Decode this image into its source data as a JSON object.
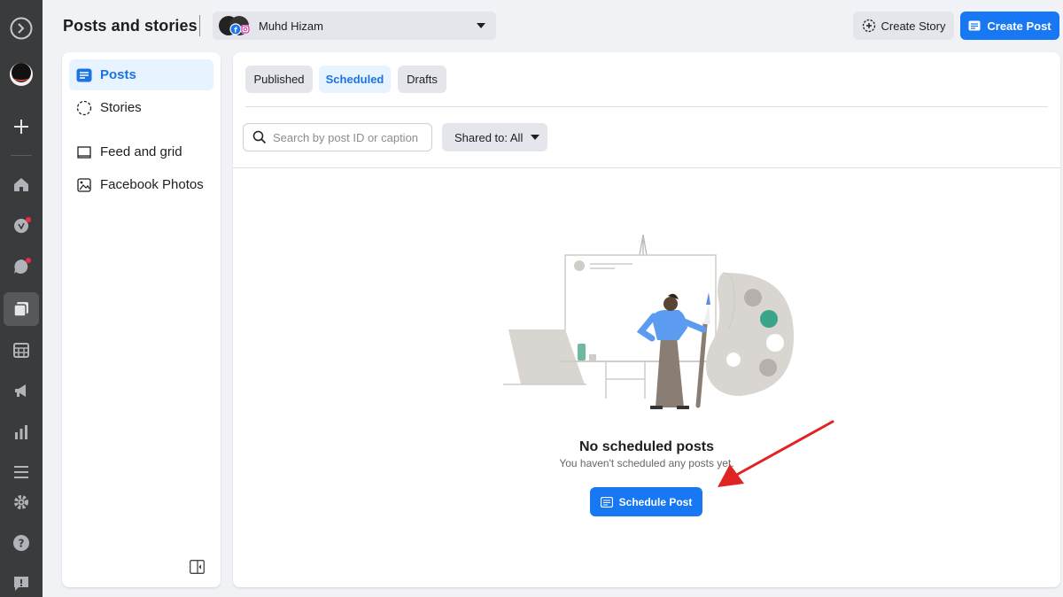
{
  "header": {
    "title": "Posts and stories",
    "account_name": "Muhd Hizam",
    "create_story_label": "Create Story",
    "create_post_label": "Create Post"
  },
  "rail": {
    "icons": [
      "meta-logo-icon",
      "profile-avatar",
      "plus-icon",
      "home-icon",
      "notifications-icon",
      "inbox-icon",
      "posts-icon",
      "calendar-icon",
      "ads-icon",
      "insights-icon",
      "menu-icon",
      "settings-icon",
      "help-icon",
      "feedback-icon"
    ]
  },
  "sidebar": {
    "items": [
      {
        "label": "Posts",
        "icon": "posts-icon",
        "active": true
      },
      {
        "label": "Stories",
        "icon": "stories-icon",
        "active": false
      },
      {
        "label": "Feed and grid",
        "icon": "feed-grid-icon",
        "active": false
      },
      {
        "label": "Facebook Photos",
        "icon": "photos-icon",
        "active": false
      }
    ]
  },
  "main": {
    "tabs": [
      {
        "label": "Published",
        "active": false
      },
      {
        "label": "Scheduled",
        "active": true
      },
      {
        "label": "Drafts",
        "active": false
      }
    ],
    "search_placeholder": "Search by post ID or caption",
    "filter_label": "Shared to: All",
    "empty_title": "No scheduled posts",
    "empty_subtitle": "You haven't scheduled any posts yet.",
    "schedule_button_label": "Schedule Post"
  },
  "colors": {
    "accent": "#1877f2",
    "rail_bg": "#3a3b3c",
    "annotation_arrow": "#e02424"
  }
}
